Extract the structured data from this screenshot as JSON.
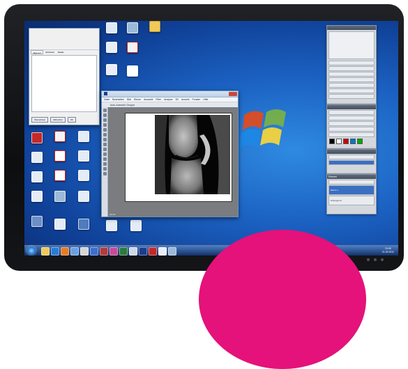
{
  "ps_window": {
    "menu": [
      "Datei",
      "Bearbeiten",
      "Bild",
      "Ebene",
      "Auswahl",
      "Filter",
      "Analyse",
      "3D",
      "Ansicht",
      "Fenster",
      "Hilfe"
    ],
    "options_bar": "Auto-Auswahl:  Gruppe",
    "zoom": "33,3%"
  },
  "small_dialog": {
    "tabs": [
      "Allgemein",
      "Sicherheit",
      "Details",
      "Vorgängerversionen"
    ],
    "buttons": [
      "Übernehmen",
      "Abbrechen",
      "OK"
    ]
  },
  "layers_panel": {
    "title": "Ebenen",
    "layers": [
      "Hintergrund",
      "Ebene 1"
    ]
  },
  "taskbar": {
    "time": "13:45",
    "date": "21.09.2011"
  },
  "colors": {
    "accent": "#e4127a",
    "desktop": "#1c63c4",
    "taskbar": "#1d3d7a"
  }
}
